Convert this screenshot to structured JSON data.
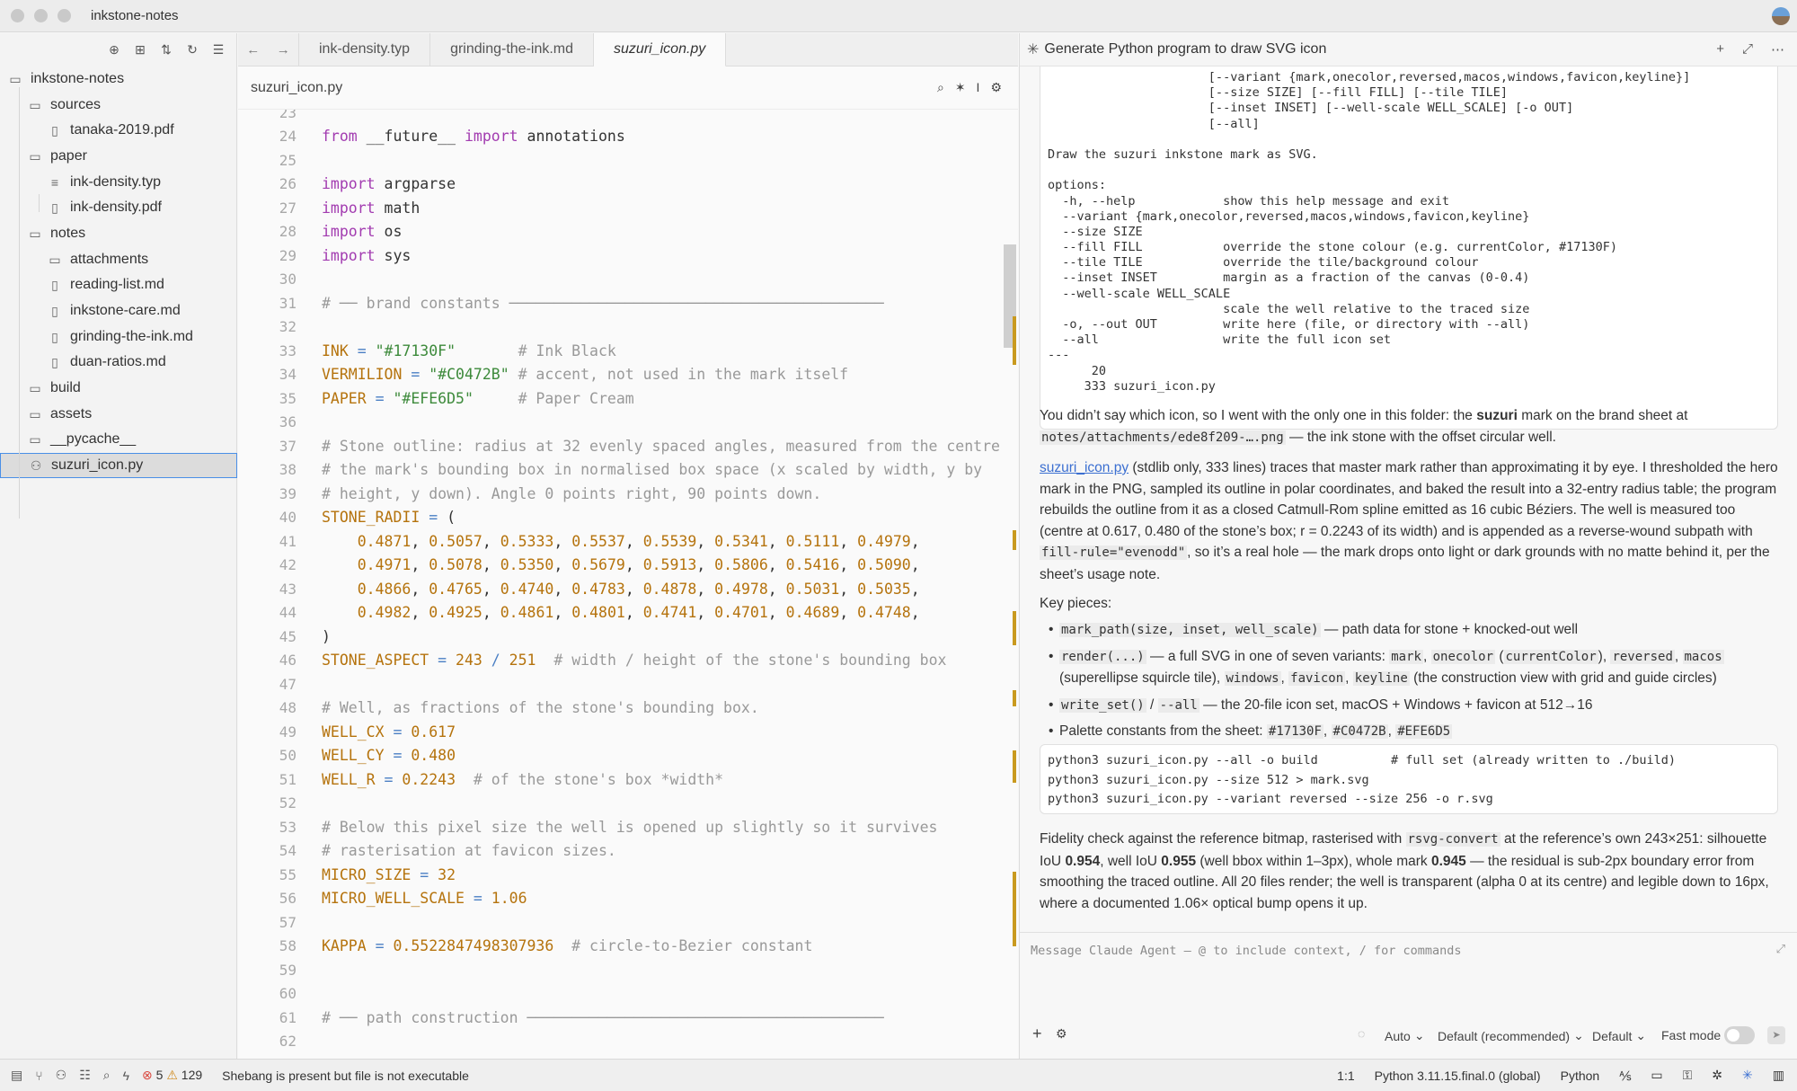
{
  "window": {
    "title": "inkstone-notes"
  },
  "sidebar": {
    "items": [
      {
        "label": "inkstone-notes",
        "icon": "folder-icon",
        "depth": 0
      },
      {
        "label": "sources",
        "icon": "folder-icon",
        "depth": 1
      },
      {
        "label": "tanaka-2019.pdf",
        "icon": "book-icon",
        "depth": 2
      },
      {
        "label": "paper",
        "icon": "folder-icon",
        "depth": 1
      },
      {
        "label": "ink-density.typ",
        "icon": "lines-icon",
        "depth": 2
      },
      {
        "label": "ink-density.pdf",
        "icon": "book-icon",
        "depth": 2
      },
      {
        "label": "notes",
        "icon": "folder-icon",
        "depth": 1
      },
      {
        "label": "attachments",
        "icon": "folder-icon",
        "depth": 2
      },
      {
        "label": "reading-list.md",
        "icon": "book-icon",
        "depth": 2
      },
      {
        "label": "inkstone-care.md",
        "icon": "book-icon",
        "depth": 2
      },
      {
        "label": "grinding-the-ink.md",
        "icon": "book-icon",
        "depth": 2
      },
      {
        "label": "duan-ratios.md",
        "icon": "book-icon",
        "depth": 2
      },
      {
        "label": "build",
        "icon": "folder-icon",
        "depth": 1
      },
      {
        "label": "assets",
        "icon": "folder-icon",
        "depth": 1
      },
      {
        "label": "__pycache__",
        "icon": "folder-icon",
        "depth": 1
      },
      {
        "label": "suzuri_icon.py",
        "icon": "python-file-icon",
        "depth": 1
      }
    ]
  },
  "tabs": [
    {
      "label": "ink-density.typ"
    },
    {
      "label": "grinding-the-ink.md"
    },
    {
      "label": "suzuri_icon.py"
    }
  ],
  "editor": {
    "filename": "suzuri_icon.py",
    "lines": [
      {
        "n": "23",
        "t": ""
      },
      {
        "n": "24",
        "t": "from __future__ import annotations"
      },
      {
        "n": "25",
        "t": ""
      },
      {
        "n": "26",
        "t": "import argparse"
      },
      {
        "n": "27",
        "t": "import math"
      },
      {
        "n": "28",
        "t": "import os"
      },
      {
        "n": "29",
        "t": "import sys"
      },
      {
        "n": "30",
        "t": ""
      },
      {
        "n": "31",
        "t": "# ── brand constants ──────────────────────────────────────────"
      },
      {
        "n": "32",
        "t": ""
      },
      {
        "n": "33",
        "t": "INK = \"#17130F\"       # Ink Black"
      },
      {
        "n": "34",
        "t": "VERMILION = \"#C0472B\" # accent, not used in the mark itself"
      },
      {
        "n": "35",
        "t": "PAPER = \"#EFE6D5\"     # Paper Cream"
      },
      {
        "n": "36",
        "t": ""
      },
      {
        "n": "37",
        "t": "# Stone outline: radius at 32 evenly spaced angles, measured from the centre"
      },
      {
        "n": "38",
        "t": "# the mark's bounding box in normalised box space (x scaled by width, y by"
      },
      {
        "n": "39",
        "t": "# height, y down). Angle 0 points right, 90 points down."
      },
      {
        "n": "40",
        "t": "STONE_RADII = ("
      },
      {
        "n": "41",
        "t": "    0.4871, 0.5057, 0.5333, 0.5537, 0.5539, 0.5341, 0.5111, 0.4979,"
      },
      {
        "n": "42",
        "t": "    0.4971, 0.5078, 0.5350, 0.5679, 0.5913, 0.5806, 0.5416, 0.5090,"
      },
      {
        "n": "43",
        "t": "    0.4866, 0.4765, 0.4740, 0.4783, 0.4878, 0.4978, 0.5031, 0.5035,"
      },
      {
        "n": "44",
        "t": "    0.4982, 0.4925, 0.4861, 0.4801, 0.4741, 0.4701, 0.4689, 0.4748,"
      },
      {
        "n": "45",
        "t": ")"
      },
      {
        "n": "46",
        "t": "STONE_ASPECT = 243 / 251  # width / height of the stone's bounding box"
      },
      {
        "n": "47",
        "t": ""
      },
      {
        "n": "48",
        "t": "# Well, as fractions of the stone's bounding box."
      },
      {
        "n": "49",
        "t": "WELL_CX = 0.617"
      },
      {
        "n": "50",
        "t": "WELL_CY = 0.480"
      },
      {
        "n": "51",
        "t": "WELL_R = 0.2243  # of the stone's box *width*"
      },
      {
        "n": "52",
        "t": ""
      },
      {
        "n": "53",
        "t": "# Below this pixel size the well is opened up slightly so it survives"
      },
      {
        "n": "54",
        "t": "# rasterisation at favicon sizes."
      },
      {
        "n": "55",
        "t": "MICRO_SIZE = 32"
      },
      {
        "n": "56",
        "t": "MICRO_WELL_SCALE = 1.06"
      },
      {
        "n": "57",
        "t": ""
      },
      {
        "n": "58",
        "t": "KAPPA = 0.5522847498307936  # circle-to-Bezier constant"
      },
      {
        "n": "59",
        "t": ""
      },
      {
        "n": "60",
        "t": ""
      },
      {
        "n": "61",
        "t": "# ── path construction ────────────────────────────────────────"
      },
      {
        "n": "62",
        "t": ""
      }
    ]
  },
  "agent": {
    "title": "Generate Python program to draw SVG icon",
    "terminal": [
      "                      [--variant {mark,onecolor,reversed,macos,windows,favicon,keyline}]",
      "                      [--size SIZE] [--fill FILL] [--tile TILE]",
      "                      [--inset INSET] [--well-scale WELL_SCALE] [-o OUT]",
      "                      [--all]",
      "",
      "Draw the suzuri inkstone mark as SVG.",
      "",
      "options:",
      "  -h, --help            show this help message and exit",
      "  --variant {mark,onecolor,reversed,macos,windows,favicon,keyline}",
      "  --size SIZE",
      "  --fill FILL           override the stone colour (e.g. currentColor, #17130F)",
      "  --tile TILE           override the tile/background colour",
      "  --inset INSET         margin as a fraction of the canvas (0-0.4)",
      "  --well-scale WELL_SCALE",
      "                        scale the well relative to the traced size",
      "  -o, --out OUT         write here (file, or directory with --all)",
      "  --all                 write the full icon set",
      "---",
      "      20",
      "     333 suzuri_icon.py"
    ],
    "para1": {
      "a": "You didn’t say which icon, so I went with the only one in this folder: the ",
      "b": "suzuri",
      "c": " mark on the brand sheet at ",
      "d": "notes/attachments/ede8f209-….png",
      "e": " — the ink stone with the offset circular well."
    },
    "para2": {
      "link": "suzuri_icon.py",
      "a": " (stdlib only, 333 lines) traces that master mark rather than approximating it by eye. I thresholded the hero mark in the PNG, sampled its outline in polar coordinates, and baked the result into a 32-entry radius table; the program rebuilds the outline from it as a closed Catmull-Rom spline emitted as 16 cubic Béziers. The well is measured too (centre at 0.617, 0.480 of the stone’s box; r = 0.2243 of its width) and is appended as a reverse-wound subpath with ",
      "code": "fill-rule=\"evenodd\"",
      "b": ", so it’s a real hole — the mark drops onto light or dark grounds with no matte behind it, per the sheet’s usage note."
    },
    "key_pieces": "Key pieces:",
    "bullets": {
      "b1": {
        "code": "mark_path(size, inset, well_scale)",
        "text": " — path data for stone + knocked-out well"
      },
      "b2": {
        "code": "render(...)",
        "t1": " — a full SVG in one of seven variants: ",
        "v1": "mark",
        "v2": "onecolor",
        "v3": "currentColor",
        "v4": "reversed",
        "v5": "macos",
        "t2": " (superellipse squircle tile), ",
        "v6": "windows",
        "v7": "favicon",
        "v8": "keyline",
        "t3": " (the construction view with grid and guide circles)"
      },
      "b3": {
        "code1": "write_set()",
        "code2": "--all",
        "text": " — the 20-file icon set, macOS + Windows + favicon at 512→16"
      },
      "b4": {
        "text": "Palette constants from the sheet: ",
        "c1": "#17130F",
        "c2": "#C0472B",
        "c3": "#EFE6D5"
      }
    },
    "commands": [
      "python3 suzuri_icon.py --all -o build          # full set (already written to ./build)",
      "python3 suzuri_icon.py --size 512 > mark.svg",
      "python3 suzuri_icon.py --variant reversed --size 256 -o r.svg"
    ],
    "para3": {
      "a": "Fidelity check against the reference bitmap, rasterised with ",
      "code": "rsvg-convert",
      "b": " at the reference’s own 243×251: silhouette IoU ",
      "v1": "0.954",
      "c": ", well IoU ",
      "v2": "0.955",
      "d": " (well bbox within 1–3px), whole mark ",
      "v3": "0.945",
      "e": " — the residual is sub-2px boundary error from smoothing the traced outline. All 20 files render; the well is transparent (alpha 0 at its centre) and legible down to 16px, where a documented 1.06× optical bump opens it up."
    },
    "composer": {
      "placeholder": "Message Claude Agent — @ to include context, / for commands",
      "mode": "Auto",
      "model": "Default (recommended)",
      "effort": "Default",
      "fast_mode": "Fast mode",
      "fast_mode_on": false
    }
  },
  "statusbar": {
    "errors": "5",
    "warnings": "129",
    "message": "Shebang is present but file is not executable",
    "cursor": "1:1",
    "interpreter": "Python 3.11.15.final.0 (global)",
    "language": "Python"
  }
}
